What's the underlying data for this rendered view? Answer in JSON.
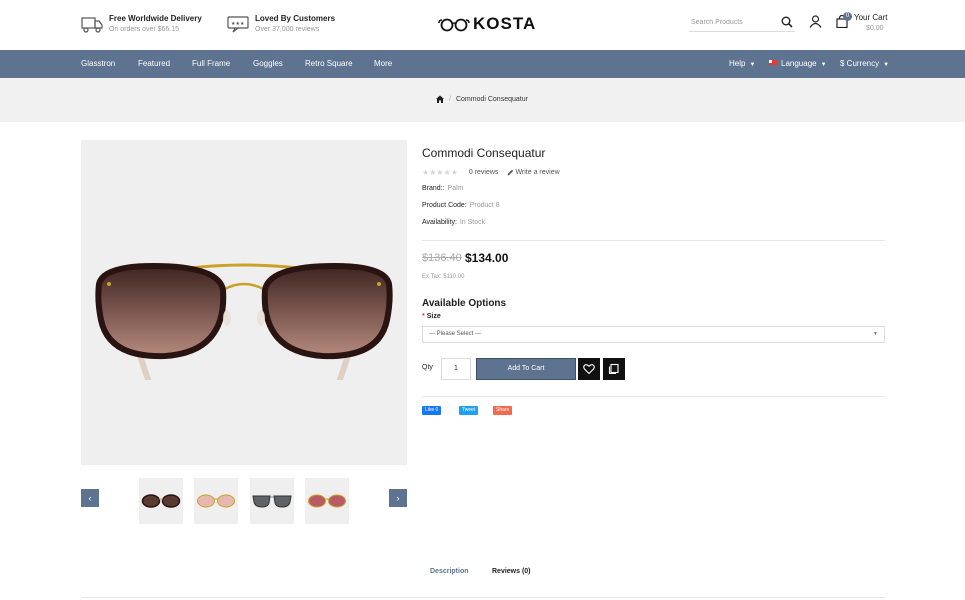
{
  "header": {
    "features": [
      {
        "title": "Free Worldwide Delivery",
        "subtitle": "On orders over $66.15",
        "icon": "truck-icon"
      },
      {
        "title": "Loved By Customers",
        "subtitle": "Over 37,000 reviews",
        "icon": "rating-icon"
      }
    ],
    "logo": "KOSTA",
    "search_placeholder": "Search Products",
    "cart_title": "Your Cart",
    "cart_total": "$0.00",
    "cart_count": "0"
  },
  "nav": {
    "items": [
      "Glasstron",
      "Featured",
      "Full Frame",
      "Goggles",
      "Retro Square",
      "More"
    ],
    "help": "Help",
    "language": "Language",
    "currency": "$ Currency"
  },
  "breadcrumb": {
    "separator": "/",
    "current": "Commodi Consequatur"
  },
  "gallery": {
    "prev": "‹",
    "next": "›"
  },
  "product": {
    "title": "Commodi Consequatur",
    "stars": "★★★★★",
    "rating_value": 0,
    "reviews": "0 reviews",
    "write_review": "Write a review",
    "brand_label": "Brand::",
    "brand": "Palm",
    "code_label": "Product Code:",
    "code": "Product 8",
    "availability_label": "Availability:",
    "availability": "In Stock",
    "old_price": "$136.40",
    "price": "$134.00",
    "ex_tax": "Ex Tax: $110.00",
    "options_title": "Available Options",
    "size_required": "*",
    "size_label": "Size",
    "size_selected": "--- Please Select ---",
    "qty_label": "Qty",
    "qty_value": "1",
    "add_to_cart": "Add To Cart"
  },
  "social": {
    "facebook": "Like 0",
    "twitter": "Tweet",
    "share": "Share"
  },
  "tabs": {
    "description": "Description",
    "reviews": "Reviews (0)"
  },
  "colors": {
    "accent": "#5d7390",
    "breadcrumb_bg": "#f1f1f1",
    "image_bg": "#efefef",
    "facebook": "#1877f2",
    "twitter": "#1da1f2",
    "share": "#f5694e"
  }
}
